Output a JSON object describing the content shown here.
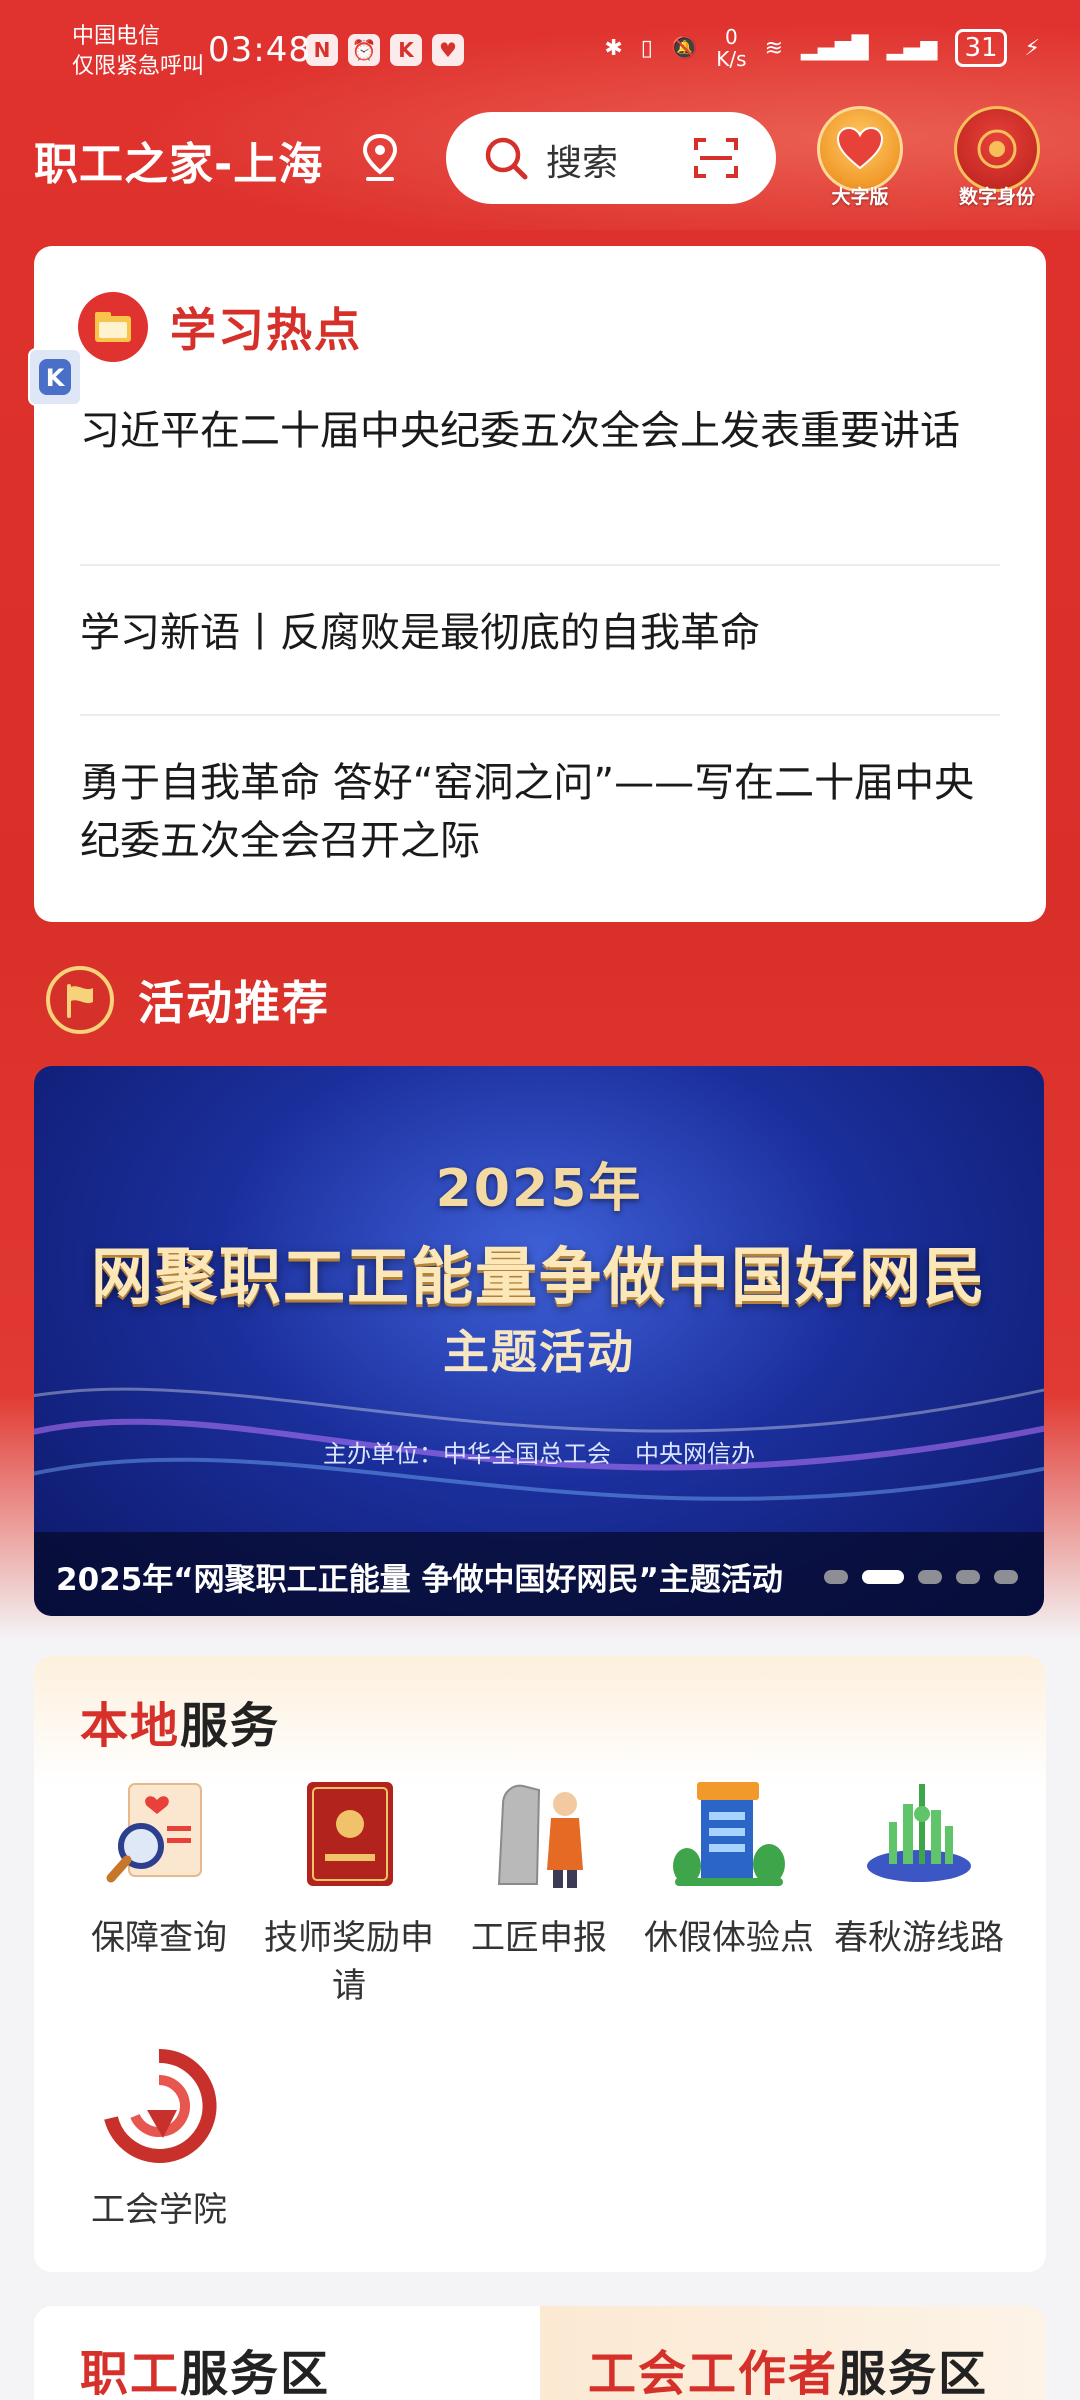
{
  "status_bar": {
    "carrier_line1": "中国电信",
    "carrier_line2": "仅限紧急呼叫",
    "time": "03:48",
    "net_speed_value": "0",
    "net_speed_unit": "K/s",
    "battery": "31"
  },
  "header": {
    "title": "职工之家-上海",
    "search_label": "搜索",
    "large_font_label": "大字版",
    "digital_id_label": "数字身份"
  },
  "study": {
    "title": "学习热点",
    "items": [
      "习近平在二十届中央纪委五次全会上发表重要讲话",
      "学习新语丨反腐败是最彻底的自我革命",
      "勇于自我革命 答好“窑洞之问”——写在二十届中央纪委五次全会召开之际"
    ]
  },
  "activities": {
    "title": "活动推荐",
    "banner": {
      "year": "2025年",
      "main": "网聚职工正能量争做中国好网民",
      "sub": "主题活动",
      "organizer": "主办单位：中华全国总工会　中央网信办",
      "caption": "2025年“网聚职工正能量 争做中国好网民”主题活动"
    },
    "carousel_count": 5,
    "carousel_active_index": 1
  },
  "local_services": {
    "title_red": "本地",
    "title_rest": "服务",
    "items": [
      {
        "label": "保障查询",
        "icon": "document-magnifier-icon"
      },
      {
        "label": "技师奖励申请",
        "icon": "certificate-book-icon"
      },
      {
        "label": "工匠申报",
        "icon": "craftsman-icon"
      },
      {
        "label": "休假体验点",
        "icon": "sanatorium-building-icon"
      },
      {
        "label": "春秋游线路",
        "icon": "city-skyline-icon"
      },
      {
        "label": "工会学院",
        "icon": "union-academy-logo-icon"
      }
    ]
  },
  "bottom": {
    "left_red": "职工",
    "left_rest": "服务区",
    "right_red": "工会工作者",
    "right_rest": "服务区"
  },
  "colors": {
    "brand_red": "#d6302b",
    "header_red": "#e0322e",
    "gold": "#f6d27a"
  }
}
